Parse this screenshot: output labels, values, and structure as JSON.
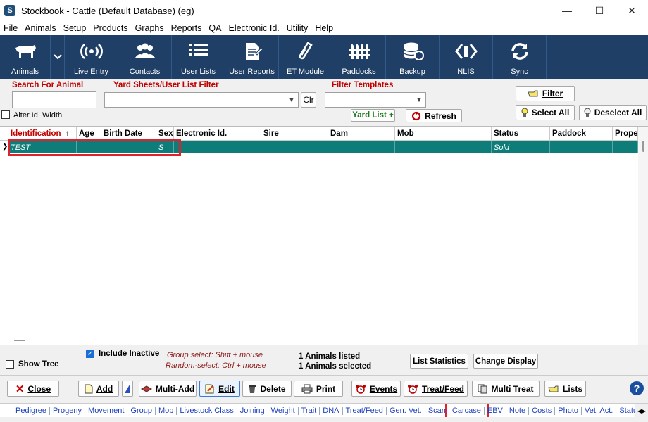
{
  "window": {
    "title": "Stockbook - Cattle (Default Database) (eg)",
    "minimize": "—",
    "maximize": "☐",
    "close": "✕"
  },
  "menu": [
    "File",
    "Animals",
    "Setup",
    "Products",
    "Graphs",
    "Reports",
    "QA",
    "Electronic Id.",
    "Utility",
    "Help"
  ],
  "toolbar": {
    "animals": "Animals",
    "live_entry": "Live Entry",
    "contacts": "Contacts",
    "user_lists": "User Lists",
    "user_reports": "User Reports",
    "et_module": "ET Module",
    "paddocks": "Paddocks",
    "backup": "Backup",
    "nlis": "NLIS",
    "sync": "Sync"
  },
  "filters": {
    "search_label": "Search For Animal",
    "search_value": "",
    "yard_label": "Yard Sheets/User List Filter",
    "yard_value": "",
    "clr": "Clr",
    "templates_label": "Filter Templates",
    "templates_value": "",
    "alter_width": "Alter Id. Width",
    "yard_list": "Yard List +",
    "refresh": "Refresh",
    "filter": "Filter",
    "select_all": "Select All",
    "deselect_all": "Deselect All"
  },
  "grid": {
    "columns": [
      "Identification",
      "Age",
      "Birth Date",
      "Sex",
      "Electronic Id.",
      "Sire",
      "Dam",
      "Mob",
      "Status",
      "Paddock",
      "Prope"
    ],
    "sort_indicator": "↑",
    "row_marker": "❯",
    "rows": [
      [
        "TEST",
        "",
        "",
        "S",
        "",
        "",
        "",
        "",
        "Sold",
        "",
        ""
      ]
    ]
  },
  "status": {
    "include_inactive": "Include Inactive",
    "show_tree": "Show Tree",
    "hint_group": "Group select: Shift + mouse",
    "hint_random": "Random-select: Ctrl + mouse",
    "listed": "1 Animals listed",
    "selected": "1 Animals selected",
    "list_statistics": "List Statistics",
    "change_display": "Change Display"
  },
  "actions": {
    "close": "Close",
    "add": "Add",
    "multi_add": "Multi-Add",
    "edit": "Edit",
    "delete": "Delete",
    "print": "Print",
    "events": "Events",
    "treat_feed": "Treat/Feed",
    "multi_treat": "Multi Treat",
    "lists": "Lists",
    "help": "?"
  },
  "tabs": [
    "Pedigree",
    "Progeny",
    "Movement",
    "Group",
    "Mob",
    "Livestock Class",
    "Joining",
    "Weight",
    "Trait",
    "DNA",
    "Treat/Feed",
    "Gen. Vet.",
    "Scan",
    "Carcase",
    "EBV",
    "Note",
    "Costs",
    "Photo",
    "Vet. Act.",
    "Status"
  ],
  "colors": {
    "toolbar_bg": "#1f3f66",
    "selected_row": "#0e7d7a",
    "accent_red": "#c00000",
    "highlight_box": "#e0202a",
    "tab_link": "#1a3fbf"
  }
}
